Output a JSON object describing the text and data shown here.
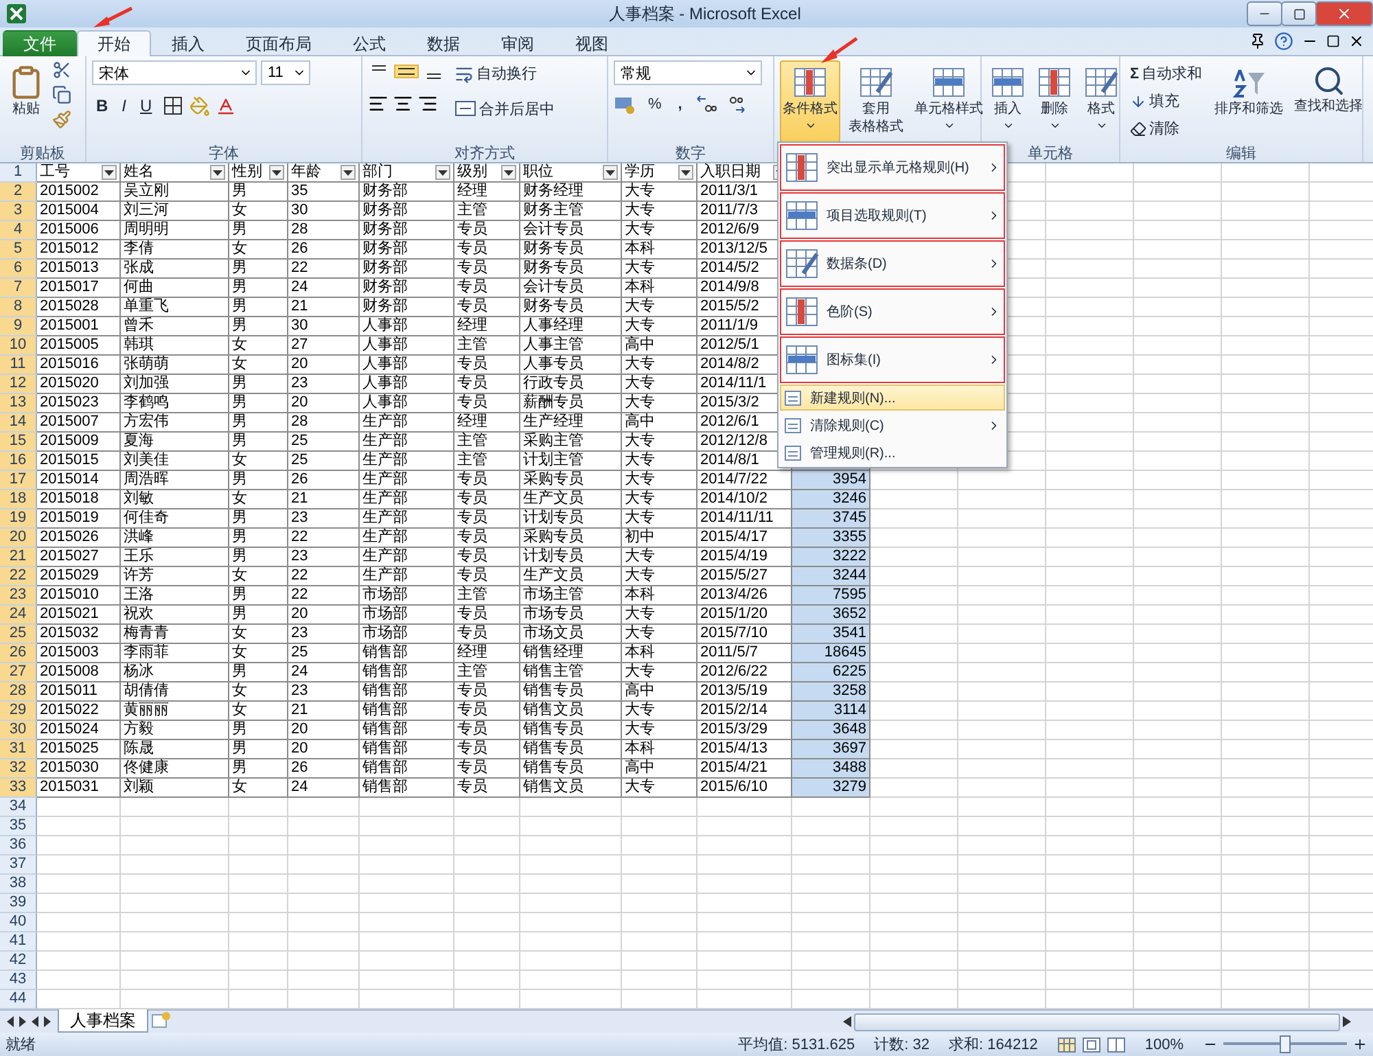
{
  "window": {
    "title": "人事档案  -  Microsoft Excel"
  },
  "tabs": [
    {
      "label": "文件",
      "kind": "file",
      "selected": false
    },
    {
      "label": "开始",
      "kind": "tab",
      "selected": true
    },
    {
      "label": "插入",
      "kind": "tab",
      "selected": false
    },
    {
      "label": "页面布局",
      "kind": "tab",
      "selected": false
    },
    {
      "label": "公式",
      "kind": "tab",
      "selected": false
    },
    {
      "label": "数据",
      "kind": "tab",
      "selected": false
    },
    {
      "label": "审阅",
      "kind": "tab",
      "selected": false
    },
    {
      "label": "视图",
      "kind": "tab",
      "selected": false
    }
  ],
  "ribbon": {
    "clipboard": {
      "label": "剪贴板",
      "paste": "粘贴"
    },
    "font": {
      "label": "字体",
      "font_name": "宋体",
      "font_size": "11",
      "bold": "B",
      "italic": "I",
      "underline": "U"
    },
    "alignment": {
      "label": "对齐方式",
      "wrap": "自动换行",
      "merge": "合并后居中"
    },
    "number": {
      "label": "数字",
      "format": "常规",
      "percent": "%",
      "comma": ","
    },
    "styles": {
      "conditional": "条件格式",
      "conditional_open": true,
      "table_format": [
        "套用",
        "表格格式"
      ],
      "cell_styles": "单元格样式"
    },
    "cells": {
      "label": "单元格",
      "buttons": [
        "插入",
        "删除",
        "格式"
      ]
    },
    "editing": {
      "label": "编辑",
      "sum_symbol": "Σ",
      "autosum": "自动求和",
      "fill": "填充",
      "clear": "清除",
      "sort": "排序和筛选",
      "find": "查找和选择"
    }
  },
  "sheet": {
    "rows": [
      {
        "number": "1",
        "kind": "header",
        "selected": false,
        "cells": [
          "工号",
          "姓名",
          "性别",
          "年龄",
          "部门",
          "级别",
          "职位",
          "学历",
          "入职日期"
        ]
      },
      {
        "number": "2",
        "kind": "data",
        "selected": true,
        "cells": [
          "2015002",
          "吴立刚",
          "男",
          "35",
          "财务部",
          "经理",
          "财务经理",
          "大专",
          "2011/3/1"
        ]
      },
      {
        "number": "3",
        "kind": "data",
        "selected": true,
        "cells": [
          "2015004",
          "刘三河",
          "女",
          "30",
          "财务部",
          "主管",
          "财务主管",
          "大专",
          "2011/7/3"
        ]
      },
      {
        "number": "4",
        "kind": "data",
        "selected": true,
        "cells": [
          "2015006",
          "周明明",
          "男",
          "28",
          "财务部",
          "专员",
          "会计专员",
          "大专",
          "2012/6/9"
        ]
      },
      {
        "number": "5",
        "kind": "data",
        "selected": true,
        "cells": [
          "2015012",
          "李倩",
          "女",
          "26",
          "财务部",
          "专员",
          "财务专员",
          "本科",
          "2013/12/5"
        ]
      },
      {
        "number": "6",
        "kind": "data",
        "selected": true,
        "cells": [
          "2015013",
          "张成",
          "男",
          "22",
          "财务部",
          "专员",
          "财务专员",
          "大专",
          "2014/5/2"
        ]
      },
      {
        "number": "7",
        "kind": "data",
        "selected": true,
        "cells": [
          "2015017",
          "何曲",
          "男",
          "24",
          "财务部",
          "专员",
          "会计专员",
          "本科",
          "2014/9/8"
        ]
      },
      {
        "number": "8",
        "kind": "data",
        "selected": true,
        "cells": [
          "2015028",
          "单重飞",
          "男",
          "21",
          "财务部",
          "专员",
          "财务专员",
          "大专",
          "2015/5/2"
        ]
      },
      {
        "number": "9",
        "kind": "data",
        "selected": true,
        "cells": [
          "2015001",
          "曾禾",
          "男",
          "30",
          "人事部",
          "经理",
          "人事经理",
          "大专",
          "2011/1/9"
        ]
      },
      {
        "number": "10",
        "kind": "data",
        "selected": true,
        "cells": [
          "2015005",
          "韩琪",
          "女",
          "27",
          "人事部",
          "主管",
          "人事主管",
          "高中",
          "2012/5/1"
        ]
      },
      {
        "number": "11",
        "kind": "data",
        "selected": true,
        "cells": [
          "2015016",
          "张萌萌",
          "女",
          "20",
          "人事部",
          "专员",
          "人事专员",
          "大专",
          "2014/8/2"
        ]
      },
      {
        "number": "12",
        "kind": "data",
        "selected": true,
        "cells": [
          "2015020",
          "刘加强",
          "男",
          "23",
          "人事部",
          "专员",
          "行政专员",
          "大专",
          "2014/11/1"
        ]
      },
      {
        "number": "13",
        "kind": "data",
        "selected": true,
        "cells": [
          "2015023",
          "李鹤鸣",
          "男",
          "20",
          "人事部",
          "专员",
          "薪酬专员",
          "大专",
          "2015/3/2"
        ]
      },
      {
        "number": "14",
        "kind": "data",
        "selected": true,
        "cells": [
          "2015007",
          "方宏伟",
          "男",
          "28",
          "生产部",
          "经理",
          "生产经理",
          "高中",
          "2012/6/1"
        ]
      },
      {
        "number": "15",
        "kind": "data",
        "selected": true,
        "cells": [
          "2015009",
          "夏海",
          "男",
          "25",
          "生产部",
          "主管",
          "采购主管",
          "大专",
          "2012/12/8"
        ]
      },
      {
        "number": "16",
        "kind": "data",
        "selected": true,
        "cells": [
          "2015015",
          "刘美佳",
          "女",
          "25",
          "生产部",
          "主管",
          "计划主管",
          "大专",
          "2014/8/1"
        ]
      },
      {
        "number": "17",
        "kind": "data",
        "selected": true,
        "cells": [
          "2015014",
          "周浩晖",
          "男",
          "26",
          "生产部",
          "专员",
          "采购专员",
          "大专",
          "2014/7/22",
          "3954"
        ]
      },
      {
        "number": "18",
        "kind": "data",
        "selected": true,
        "cells": [
          "2015018",
          "刘敏",
          "女",
          "21",
          "生产部",
          "专员",
          "生产文员",
          "大专",
          "2014/10/2",
          "3246"
        ]
      },
      {
        "number": "19",
        "kind": "data",
        "selected": true,
        "cells": [
          "2015019",
          "何佳奇",
          "男",
          "23",
          "生产部",
          "专员",
          "计划专员",
          "大专",
          "2014/11/11",
          "3745"
        ]
      },
      {
        "number": "20",
        "kind": "data",
        "selected": true,
        "cells": [
          "2015026",
          "洪峰",
          "男",
          "22",
          "生产部",
          "专员",
          "采购专员",
          "初中",
          "2015/4/17",
          "3355"
        ]
      },
      {
        "number": "21",
        "kind": "data",
        "selected": true,
        "cells": [
          "2015027",
          "王乐",
          "男",
          "23",
          "生产部",
          "专员",
          "计划专员",
          "大专",
          "2015/4/19",
          "3222"
        ]
      },
      {
        "number": "22",
        "kind": "data",
        "selected": true,
        "cells": [
          "2015029",
          "许芳",
          "女",
          "22",
          "生产部",
          "专员",
          "生产文员",
          "大专",
          "2015/5/27",
          "3244"
        ]
      },
      {
        "number": "23",
        "kind": "data",
        "selected": true,
        "cells": [
          "2015010",
          "王洛",
          "男",
          "22",
          "市场部",
          "主管",
          "市场主管",
          "本科",
          "2013/4/26",
          "7595"
        ]
      },
      {
        "number": "24",
        "kind": "data",
        "selected": true,
        "cells": [
          "2015021",
          "祝欢",
          "男",
          "20",
          "市场部",
          "专员",
          "市场专员",
          "大专",
          "2015/1/20",
          "3652"
        ]
      },
      {
        "number": "25",
        "kind": "data",
        "selected": true,
        "cells": [
          "2015032",
          "梅青青",
          "女",
          "23",
          "市场部",
          "专员",
          "市场文员",
          "大专",
          "2015/7/10",
          "3541"
        ]
      },
      {
        "number": "26",
        "kind": "data",
        "selected": true,
        "cells": [
          "2015003",
          "李雨菲",
          "女",
          "25",
          "销售部",
          "经理",
          "销售经理",
          "本科",
          "2011/5/7",
          "18645"
        ]
      },
      {
        "number": "27",
        "kind": "data",
        "selected": true,
        "cells": [
          "2015008",
          "杨冰",
          "男",
          "24",
          "销售部",
          "主管",
          "销售主管",
          "大专",
          "2012/6/22",
          "6225"
        ]
      },
      {
        "number": "28",
        "kind": "data",
        "selected": true,
        "cells": [
          "2015011",
          "胡倩倩",
          "女",
          "23",
          "销售部",
          "专员",
          "销售专员",
          "高中",
          "2013/5/19",
          "3258"
        ]
      },
      {
        "number": "29",
        "kind": "data",
        "selected": true,
        "cells": [
          "2015022",
          "黄丽丽",
          "女",
          "21",
          "销售部",
          "专员",
          "销售文员",
          "大专",
          "2015/2/14",
          "3114"
        ]
      },
      {
        "number": "30",
        "kind": "data",
        "selected": true,
        "cells": [
          "2015024",
          "方毅",
          "男",
          "20",
          "销售部",
          "专员",
          "销售专员",
          "大专",
          "2015/3/29",
          "3648"
        ]
      },
      {
        "number": "31",
        "kind": "data",
        "selected": true,
        "cells": [
          "2015025",
          "陈晟",
          "男",
          "20",
          "销售部",
          "专员",
          "销售专员",
          "本科",
          "2015/4/13",
          "3697"
        ]
      },
      {
        "number": "32",
        "kind": "data",
        "selected": true,
        "cells": [
          "2015030",
          "佟健康",
          "男",
          "26",
          "销售部",
          "专员",
          "销售专员",
          "高中",
          "2015/4/21",
          "3488"
        ]
      },
      {
        "number": "33",
        "kind": "data",
        "selected": true,
        "cells": [
          "2015031",
          "刘颖",
          "女",
          "24",
          "销售部",
          "专员",
          "销售文员",
          "大专",
          "2015/6/10",
          "3279"
        ]
      },
      {
        "number": "34",
        "kind": "empty",
        "selected": false
      },
      {
        "number": "35",
        "kind": "empty",
        "selected": false
      },
      {
        "number": "36",
        "kind": "empty",
        "selected": false
      },
      {
        "number": "37",
        "kind": "empty",
        "selected": false
      },
      {
        "number": "38",
        "kind": "empty",
        "selected": false
      },
      {
        "number": "39",
        "kind": "empty",
        "selected": false
      },
      {
        "number": "40",
        "kind": "empty",
        "selected": false
      },
      {
        "number": "41",
        "kind": "empty",
        "selected": false
      },
      {
        "number": "42",
        "kind": "empty",
        "selected": false
      },
      {
        "number": "43",
        "kind": "empty",
        "selected": false
      },
      {
        "number": "44",
        "kind": "empty",
        "selected": false
      }
    ],
    "sheet_tabs": [
      {
        "label": "人事档案",
        "selected": true
      }
    ]
  },
  "menu": {
    "items": [
      {
        "label": "突出显示单元格规则(H)",
        "kind": "large",
        "submenu": true,
        "selected": false
      },
      {
        "label": "项目选取规则(T)",
        "kind": "large",
        "submenu": true,
        "selected": false
      },
      {
        "label": "数据条(D)",
        "kind": "large",
        "submenu": true,
        "selected": false
      },
      {
        "label": "色阶(S)",
        "kind": "large",
        "submenu": true,
        "selected": false
      },
      {
        "label": "图标集(I)",
        "kind": "large",
        "submenu": true,
        "selected": false
      },
      {
        "label": "新建规则(N)...",
        "kind": "small",
        "submenu": false,
        "selected": true
      },
      {
        "label": "清除规则(C)",
        "kind": "small",
        "submenu": true,
        "selected": false
      },
      {
        "label": "管理规则(R)...",
        "kind": "small",
        "submenu": false,
        "selected": false
      }
    ]
  },
  "status_bar": {
    "state": "就绪",
    "average": "平均值: 5131.625",
    "count": "计数: 32",
    "sum": "求和: 164212",
    "zoom": "100%",
    "zoom_slider": {
      "level": 0.5
    }
  }
}
